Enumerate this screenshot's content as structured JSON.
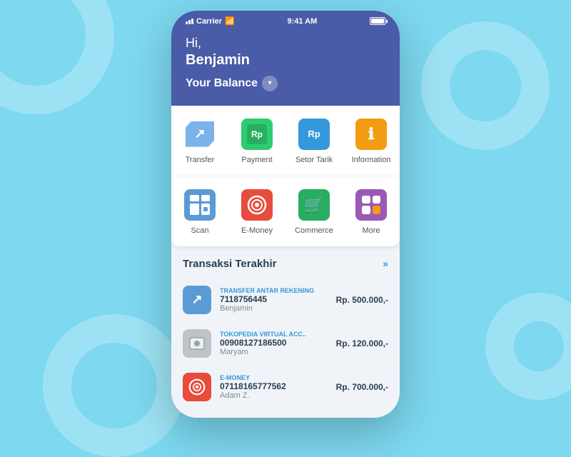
{
  "background": {
    "color": "#7dd8f0"
  },
  "statusBar": {
    "carrier": "Carrier",
    "wifi": "wifi",
    "time": "9:41 AM",
    "battery": "battery"
  },
  "header": {
    "greeting_hi": "Hi,",
    "greeting_name": "Benjamin",
    "balance_label": "Your Balance",
    "chevron": "▼"
  },
  "actions": {
    "row1": [
      {
        "label": "Transfer",
        "icon": "transfer"
      },
      {
        "label": "Payment",
        "icon": "payment"
      },
      {
        "label": "Setor Tarik",
        "icon": "setor"
      },
      {
        "label": "Information",
        "icon": "info"
      }
    ],
    "row2": [
      {
        "label": "Scan",
        "icon": "scan"
      },
      {
        "label": "E-Money",
        "icon": "emoney"
      },
      {
        "label": "Commerce",
        "icon": "commerce"
      },
      {
        "label": "More",
        "icon": "more"
      }
    ]
  },
  "transactions": {
    "title": "Transaksi Terakhir",
    "see_all": "»",
    "items": [
      {
        "type": "Transfer Antar Rekening",
        "account": "7118756445",
        "name": "Benjamin",
        "amount": "Rp. 500.000,-",
        "icon_color": "#5b9bd5",
        "icon": "transfer"
      },
      {
        "type": "Tokopedia Virtual Acc..",
        "account": "00908127186500",
        "name": "Maryam",
        "amount": "Rp. 120.000,-",
        "icon_color": "#95a5a6",
        "icon": "tokopedia"
      },
      {
        "type": "E-Money",
        "account": "07118165777562",
        "name": "Adam Z.",
        "amount": "Rp. 700.000,-",
        "icon_color": "#e74c3c",
        "icon": "emoney"
      }
    ]
  }
}
